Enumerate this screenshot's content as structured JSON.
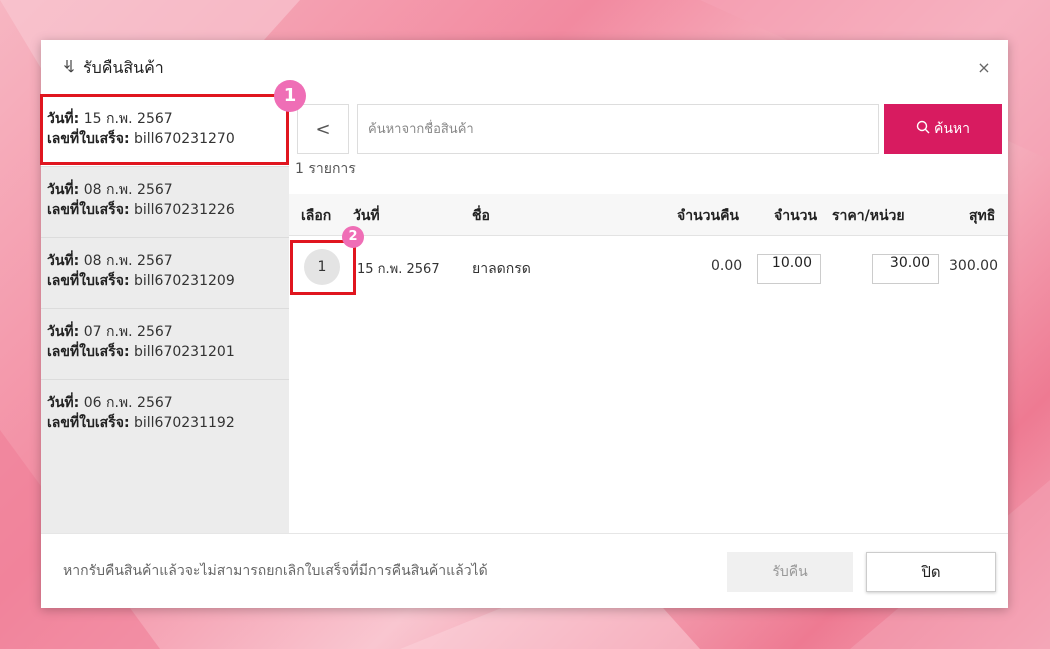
{
  "modal": {
    "title_icon": "return-arrow-icon",
    "title": "รับคืนสินค้า",
    "close_glyph": "×"
  },
  "bills": [
    {
      "date_label": "วันที่:",
      "date": "15 ก.พ. 2567",
      "receipt_label": "เลขที่ใบเสร็จ:",
      "receipt": "bill670231270"
    },
    {
      "date_label": "วันที่:",
      "date": "08 ก.พ. 2567",
      "receipt_label": "เลขที่ใบเสร็จ:",
      "receipt": "bill670231226"
    },
    {
      "date_label": "วันที่:",
      "date": "08 ก.พ. 2567",
      "receipt_label": "เลขที่ใบเสร็จ:",
      "receipt": "bill670231209"
    },
    {
      "date_label": "วันที่:",
      "date": "07 ก.พ. 2567",
      "receipt_label": "เลขที่ใบเสร็จ:",
      "receipt": "bill670231201"
    },
    {
      "date_label": "วันที่:",
      "date": "06 ก.พ. 2567",
      "receipt_label": "เลขที่ใบเสร็จ:",
      "receipt": "bill670231192"
    }
  ],
  "search": {
    "back_glyph": "<",
    "placeholder": "ค้นหาจากชื่อสินค้า",
    "button_label": "ค้นหา",
    "result_count": "1 รายการ"
  },
  "table": {
    "headers": {
      "select": "เลือก",
      "date": "วันที่",
      "name": "ชื่อ",
      "return_qty": "จำนวนคืน",
      "qty": "จำนวน",
      "unit_price": "ราคา/หน่วย",
      "net": "สุทธิ"
    },
    "rows": [
      {
        "select": "1",
        "date": "15 ก.พ. 2567",
        "name": "ยาลดกรด",
        "return_qty": "0.00",
        "qty": "10.00",
        "unit_price": "30.00",
        "net": "300.00"
      }
    ]
  },
  "annotations": {
    "badge_1": "1",
    "badge_2": "2"
  },
  "footer": {
    "note": "หากรับคืนสินค้าแล้วจะไม่สามารถยกเลิกใบเสร็จที่มีการคืนสินค้าแล้วได้",
    "return_label": "รับคืน",
    "close_label": "ปิด"
  },
  "colors": {
    "accent": "#d81b60",
    "highlight": "#e0151f",
    "badge": "#ef6eb6"
  }
}
